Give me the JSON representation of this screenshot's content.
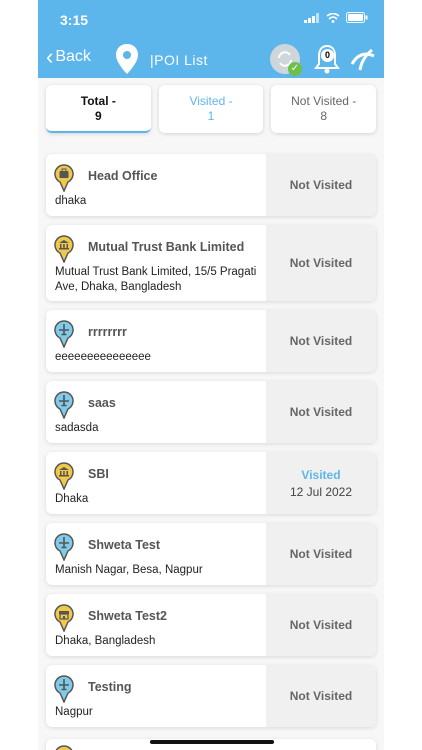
{
  "status_bar": {
    "time": "3:15"
  },
  "header": {
    "back_label": "Back",
    "title": "|POI List",
    "bell_count": "0"
  },
  "tabs": [
    {
      "line1": "Total -",
      "line2": "9"
    },
    {
      "line1": "Visited -",
      "line2": "1"
    },
    {
      "line1": "Not Visited -",
      "line2": "8"
    }
  ],
  "poi": [
    {
      "name": "Head Office",
      "address": "dhaka",
      "status": "Not Visited",
      "date": ""
    },
    {
      "name": "Mutual Trust Bank Limited",
      "address": "Mutual Trust Bank Limited, 15/5 Pragati Ave, Dhaka, Bangladesh",
      "status": "Not Visited",
      "date": ""
    },
    {
      "name": "rrrrrrrr",
      "address": "eeeeeeeeeeeeeee",
      "status": "Not Visited",
      "date": ""
    },
    {
      "name": "saas",
      "address": "sadasda",
      "status": "Not Visited",
      "date": ""
    },
    {
      "name": "SBI",
      "address": "Dhaka",
      "status": "Visited",
      "date": "12 Jul 2022"
    },
    {
      "name": "Shweta Test",
      "address": "Manish Nagar, Besa, Nagpur",
      "status": "Not Visited",
      "date": ""
    },
    {
      "name": "Shweta Test2",
      "address": "Dhaka, Bangladesh",
      "status": "Not Visited",
      "date": ""
    },
    {
      "name": "Testing",
      "address": "Nagpur",
      "status": "Not Visited",
      "date": ""
    }
  ],
  "colors": {
    "header": "#5cb6ec",
    "visited": "#5cb6ec",
    "pin_yellow": "#f0c84a",
    "pin_blue": "#7fcbe9"
  },
  "icons": [
    "briefcase-pin-icon",
    "bank-pin-icon",
    "plane-pin-icon",
    "shop-pin-icon"
  ]
}
